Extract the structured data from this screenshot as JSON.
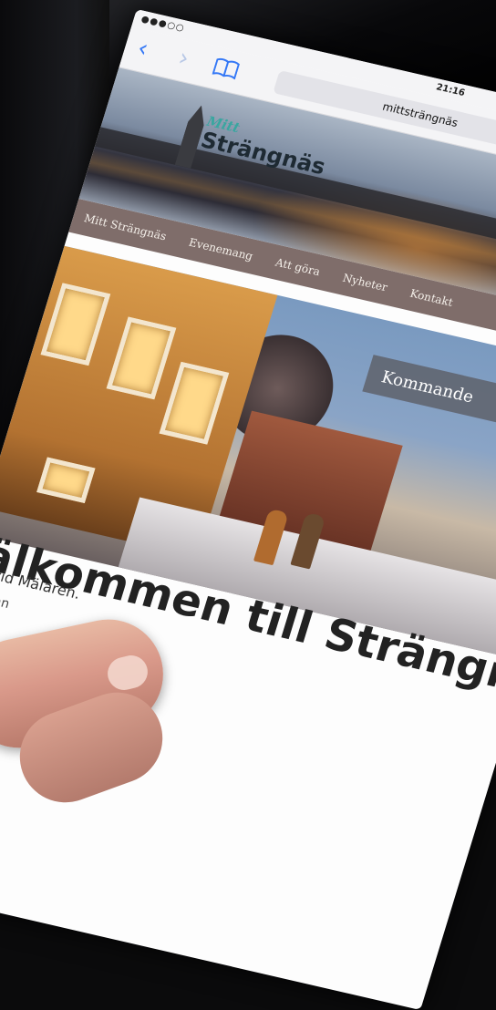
{
  "browser": {
    "time": "21:16",
    "url": "mittsträngnäs",
    "signal": "●●●○○"
  },
  "site": {
    "logo_top": "Mitt",
    "logo_main": "Strängnäs",
    "menu": [
      "Mitt Strängnäs",
      "Evenemang",
      "Att göra",
      "Nyheter",
      "Kontakt"
    ],
    "hero_button": "Kommande",
    "welcome_title": "Välkommen till Strängnäs",
    "sub_line1": "idyll vid Mälaren.",
    "sub_line2": "tron kul an"
  },
  "icons": {
    "back": "chevron-left-icon",
    "forward": "chevron-right-icon",
    "bookmarks": "book-icon"
  },
  "colors": {
    "ios_blue": "#3478f6",
    "menu_bg": "#7f6d6a",
    "logo_teal": "#3aa6a0"
  }
}
